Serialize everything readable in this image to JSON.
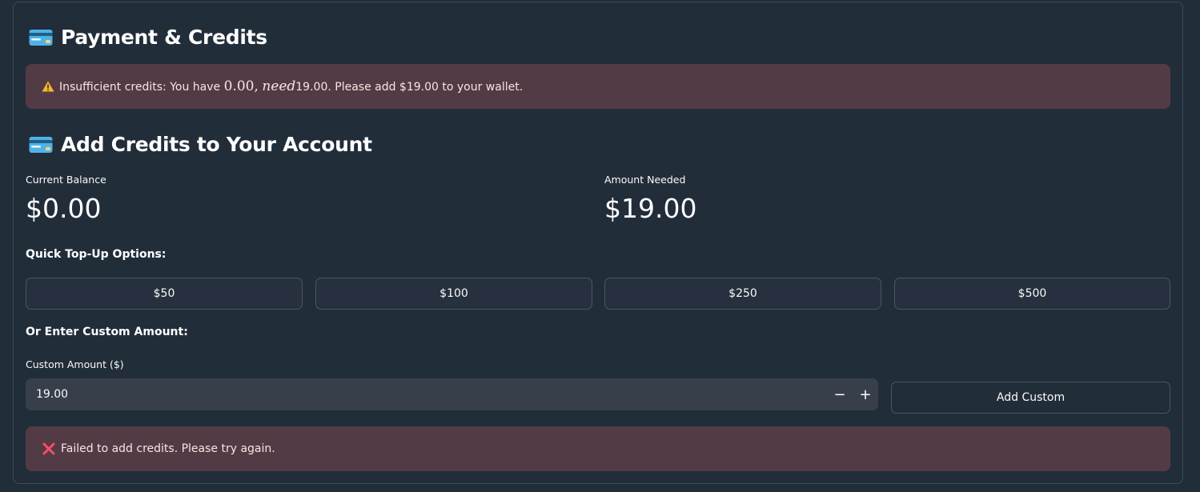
{
  "page": {
    "title": "Payment & Credits"
  },
  "warning": {
    "prefix": "Insufficient credits: You have ",
    "math_amount": "0.00,",
    "math_word": "need",
    "suffix": "19.00. Please add $19.00 to your wallet.",
    "icon": "warning-icon"
  },
  "add_credits": {
    "title": "Add Credits to Your Account"
  },
  "metrics": {
    "current_balance_label": "Current Balance",
    "current_balance_value": "$0.00",
    "amount_needed_label": "Amount Needed",
    "amount_needed_value": "$19.00"
  },
  "quick_topup": {
    "label": "Quick Top-Up Options:",
    "options": [
      "$50",
      "$100",
      "$250",
      "$500"
    ]
  },
  "custom": {
    "section_label": "Or Enter Custom Amount:",
    "field_label": "Custom Amount ($)",
    "value": "19.00",
    "minus": "−",
    "plus": "+",
    "button_label": "Add Custom"
  },
  "error": {
    "message": "Failed to add credits. Please try again.",
    "icon": "cross-icon"
  },
  "colors": {
    "background": "#222d3a",
    "alert_background": "#533b45",
    "warning_icon": "#f5b82e",
    "error_icon": "#ff4b4b"
  }
}
